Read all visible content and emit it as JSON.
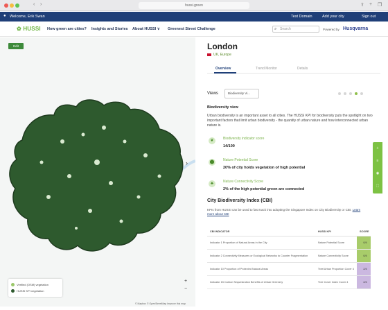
{
  "browser": {
    "url": "hussi.green",
    "back_glyph": "‹",
    "forward_glyph": "›",
    "share_glyph": "⇪",
    "add_glyph": "+",
    "tabs_glyph": "❐"
  },
  "top_strip": {
    "welcome": "Welcome, Erik Swan",
    "person_glyph": "●",
    "test_domain": "Test Domain",
    "add_city": "Add your city",
    "sign_out": "Sign out"
  },
  "nav": {
    "logo": "✿ HUSSI",
    "items": [
      "How green are cities?",
      "Insights and Stories",
      "About HUSSI ∨",
      "Greenest Street Challenge"
    ],
    "search_placeholder": "Search",
    "search_glyph": "⌕",
    "powered_by": "Powered by",
    "brand": "Husqvarna",
    "colors": {
      "nav_dark": "#1f3f78",
      "accent_green": "#6cb33f"
    }
  },
  "map": {
    "edit_label": "Edit",
    "arrow_glyph": "›",
    "zoom_in": "+",
    "zoom_out": "−",
    "attribution": "© Mapbox © OpenStreetMap Improve this map",
    "legend": [
      {
        "label": "Verified (OSM) vegetation",
        "color": "#9bc86a"
      },
      {
        "label": "HUSSI KPI vegetation",
        "color": "#2e5a2e"
      }
    ]
  },
  "panel": {
    "city": "London",
    "country": "UK, Europe",
    "tabs": [
      "Overview",
      "Trend Monitor",
      "Details"
    ],
    "views_label": "Views",
    "views_value": "Biodiversity Vi...",
    "biodiversity_heading": "Biodiversity view",
    "biodiversity_text": "Urban biodiversity is an important asset to all cities. The HUSSI KPI for biodiversity puts the spotlight on two important factors that limit urban biodiversity - the quantity of urban nature and how interconnected urban nature is.",
    "kpis": [
      {
        "icon": "leaf-icon",
        "glyph": "❦",
        "title": "Biodiversity indicator score",
        "value": "14/100"
      },
      {
        "icon": "pin-icon",
        "glyph": "⬤",
        "title": "Nature Potential Score",
        "value": "20% of city holds vegetation of high potential"
      },
      {
        "icon": "tree-icon",
        "glyph": "♣",
        "title": "Nature Connectivity Score",
        "value": "2% of the high potential green are connected"
      }
    ],
    "cbi_title": "City Biodiversity Index (CBI)",
    "cbi_text": "KPIs from HUSSI can be used to fast track into adopting the Singapore Index on City Biodiversity or CBI",
    "cbi_link": "Learn more about CBI",
    "table": {
      "headers": [
        "CBI INDICATOR",
        "HUSSI KPI",
        "SCORE"
      ],
      "rows": [
        {
          "indicator": "Indicator 1 Proportion of Natural Areas in the City",
          "kpi": "Nature Potential Score",
          "score": "0/4",
          "color": "#a8cc6a"
        },
        {
          "indicator": "Indicator 2 Connectivity Measures or Ecological Networks to Counter Fragmentation",
          "kpi": "Nature Connectivity Score",
          "score": "0/4",
          "color": "#a8cc6a"
        },
        {
          "indicator": "Indicator 10 Proportion of Protected Natural Areas",
          "kpi": "Tree/Urban Proportion Cover 4",
          "score": "2/4",
          "color": "#cbb8e0"
        },
        {
          "indicator": "Indicator 15 Carbon Sequestration Benefits of Urban Greenery",
          "kpi": "Tree Cover Index Cover 4",
          "score": "2/4",
          "color": "#cbb8e0"
        }
      ]
    },
    "side_tab_glyphs": [
      "+",
      "≡",
      "◉",
      "⬚"
    ]
  }
}
